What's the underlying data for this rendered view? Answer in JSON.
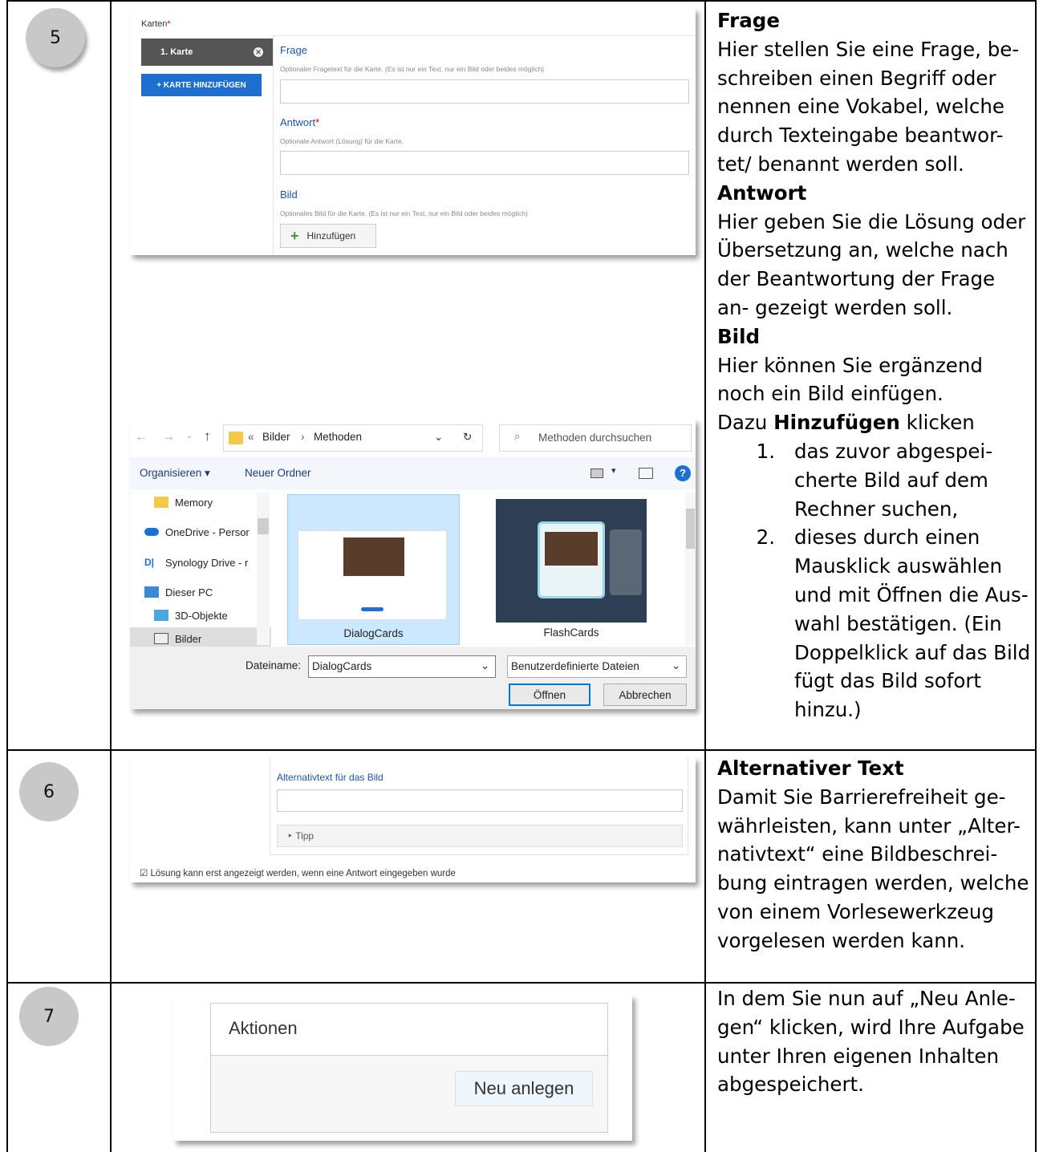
{
  "steps": [
    {
      "number": "5",
      "editor": {
        "cards_label": "Karten",
        "required_mark": "*",
        "card_tab": "1. Karte",
        "add_card_button": "+ KARTE HINZUFÜGEN",
        "question_title": "Frage",
        "question_desc": "Optionaler Fragetext für die Karte. (Es ist nur ein Text, nur ein Bild oder beides möglich)",
        "answer_title": "Antwort",
        "answer_desc": "Optionale Antwort (Lösung) für die Karte.",
        "image_title": "Bild",
        "image_desc": "Optionales Bild für die Karte. (Es ist nur ein Text, nur ein Bild oder beides möglich)",
        "add_button": "Hinzufügen"
      },
      "file_dialog": {
        "path_prefix": "«",
        "path_part1": "Bilder",
        "path_sep": "›",
        "path_part2": "Methoden",
        "search_placeholder": "Methoden durchsuchen",
        "organize": "Organisieren ▾",
        "new_folder": "Neuer Ordner",
        "nav_items": [
          "Memory",
          "OneDrive - Persor",
          "Synology Drive - r",
          "Dieser PC",
          "3D-Objekte",
          "Bilder"
        ],
        "files": [
          "DialogCards",
          "FlashCards"
        ],
        "filename_label": "Dateiname:",
        "filename_value": "DialogCards",
        "filetype_value": "Benutzerdefinierte Dateien",
        "open_button": "Öffnen",
        "cancel_button": "Abbrechen"
      },
      "description": {
        "h1": "Frage",
        "p1": "Hier stellen Sie eine Frage, be- schreiben einen Begriff oder nennen eine Vokabel, welche durch Texteingabe beantwor- tet/ benannt werden soll.",
        "h2": "Antwort",
        "p2": "Hier geben Sie die Lösung oder Übersetzung an, welche nach der Beantwortung der Frage an- gezeigt werden soll.",
        "h3": "Bild",
        "p3": "Hier können Sie ergänzend noch ein Bild einfügen.",
        "p4_pre": "Dazu",
        "p4_bold": "Hinzufügen",
        "p4_post": "klicken",
        "list": [
          {
            "num": "1.",
            "text": "das zuvor abgespei- cherte Bild auf dem Rechner suchen,"
          },
          {
            "num": "2.",
            "text": "dieses durch einen Mausklick auswählen und mit Öffnen die Aus- wahl bestätigen. (Ein Doppelklick auf das Bild fügt das Bild sofort hinzu.)"
          }
        ]
      }
    },
    {
      "number": "6",
      "shot": {
        "alt_title": "Alternativtext für das Bild",
        "tip": "‣ Tipp",
        "checkbox_label": "☑ Lösung kann erst angezeigt werden, wenn eine Antwort eingegeben wurde"
      },
      "description": {
        "h1": "Alternativer Text",
        "p1": "Damit Sie Barrierefreiheit ge- währleisten, kann unter „Alter- nativtext“ eine Bildbeschrei- bung eintragen werden, welche von einem Vorlesewerkzeug vorgelesen werden kann."
      }
    },
    {
      "number": "7",
      "shot": {
        "title": "Aktionen",
        "button": "Neu anlegen"
      },
      "description": {
        "p1": "In dem Sie nun auf „Neu Anle- gen“ klicken, wird Ihre Aufgabe unter Ihren eigenen Inhalten abgespeichert."
      }
    }
  ]
}
